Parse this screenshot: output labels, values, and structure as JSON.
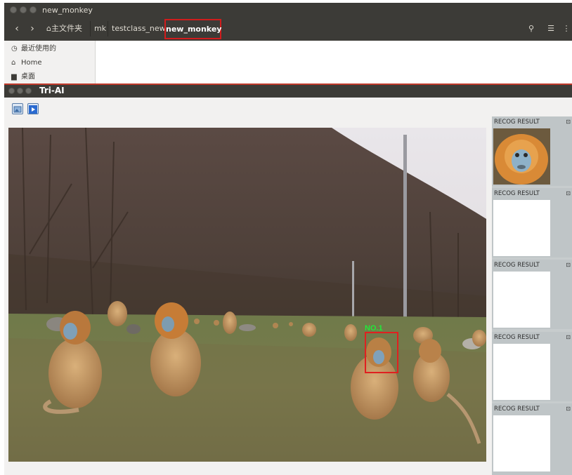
{
  "file_manager": {
    "window_title": "new_monkey",
    "breadcrumbs": [
      "主文件夹",
      "mk",
      "testclass_new",
      "new_monkey"
    ],
    "sidebar": [
      {
        "icon": "clock-icon",
        "label": "最近使用的"
      },
      {
        "icon": "home-icon",
        "label": "Home"
      },
      {
        "icon": "folder-icon",
        "label": "桌面"
      }
    ]
  },
  "app": {
    "window_title": "Tri-AI",
    "detection": {
      "label": "NO.1",
      "color": "#22e83a",
      "box_color": "#e02020"
    },
    "results": [
      {
        "header": "RECOG RESULT",
        "has_image": true
      },
      {
        "header": "RECOG RESULT",
        "has_image": false
      },
      {
        "header": "RECOG RESULT",
        "has_image": false
      },
      {
        "header": "RECOG RESULT",
        "has_image": false
      },
      {
        "header": "RECOG RESULT",
        "has_image": false
      }
    ]
  },
  "colors": {
    "titlebar": "#3c3b37",
    "highlight": "#d11c1c"
  }
}
